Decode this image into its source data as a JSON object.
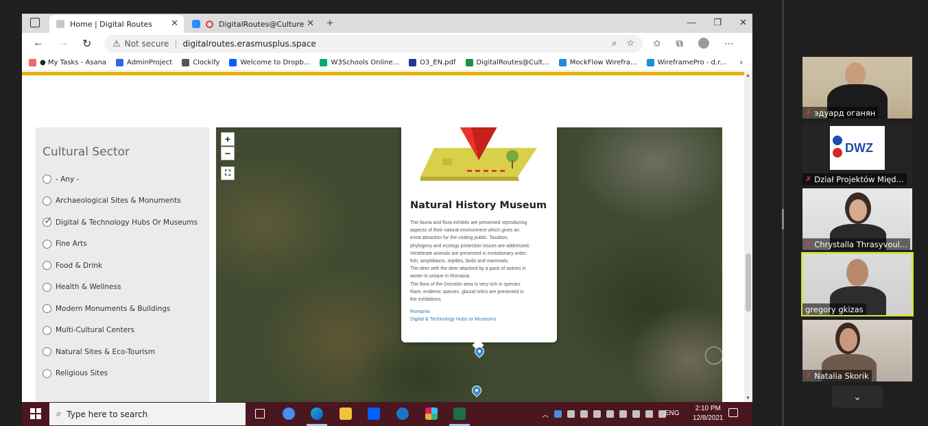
{
  "browser": {
    "tabs": [
      {
        "label": "Home | Digital Routes",
        "active": true
      },
      {
        "label": "DigitalRoutes@Culture",
        "active": false
      }
    ],
    "address": {
      "security": "Not secure",
      "url": "digitalroutes.erasmusplus.space"
    },
    "bookmarks": [
      {
        "label": "● My Tasks - Asana",
        "color": "#f06a6a"
      },
      {
        "label": "AdminProject",
        "color": "#2d6ad9"
      },
      {
        "label": "Clockify",
        "color": "#555555"
      },
      {
        "label": "Welcome to Dropb...",
        "color": "#0061fe"
      },
      {
        "label": "W3Schools Online...",
        "color": "#04aa6d"
      },
      {
        "label": "O3_EN.pdf",
        "color": "#1f3a93"
      },
      {
        "label": "DigitalRoutes@Cult...",
        "color": "#1e8e3e"
      },
      {
        "label": "MockFlow Wirefra...",
        "color": "#1b8fd6"
      },
      {
        "label": "WireframePro - d.r...",
        "color": "#1b8fd6"
      }
    ]
  },
  "sidebar": {
    "title": "Cultural Sector",
    "items": [
      {
        "label": "- Any -",
        "checked": false
      },
      {
        "label": "Archaeological Sites & Monuments",
        "checked": false
      },
      {
        "label": "Digital & Technology Hubs Or Museums",
        "checked": true
      },
      {
        "label": "Fine Arts",
        "checked": false
      },
      {
        "label": "Food & Drink",
        "checked": false
      },
      {
        "label": "Health & Wellness",
        "checked": false
      },
      {
        "label": "Modern Monuments & Buildings",
        "checked": false
      },
      {
        "label": "Multi-Cultural Centers",
        "checked": false
      },
      {
        "label": "Natural Sites & Eco-Tourism",
        "checked": false
      },
      {
        "label": "Religious Sites",
        "checked": false
      }
    ]
  },
  "map": {
    "zoom_in": "+",
    "zoom_out": "−",
    "popup": {
      "title": "Natural History Museum",
      "lines": [
        "The fauna and flora exhibits are presented reproducing",
        "aspects of their natural environment which gives an",
        "extra attraction for the visiting public. Taxation,",
        "phylogeny and ecology protection issues are addressed.",
        "Vertebrate animals are presented in evolutionary order:",
        "fish, amphibians, reptiles, birds and mammals.",
        "The deer with the deer attacked by a pack of wolves in",
        "winter is unique in Romania.",
        "The flora of the Dornelor area is very rich in species.",
        "Rare, endemic species, glacial relics are presented in",
        "the exhibitions"
      ],
      "country_link": "Romania",
      "category_link": "Digital & Technology Hubs or Museums"
    }
  },
  "taskbar": {
    "search_placeholder": "Type here to search",
    "language": "ENG",
    "time": "2:10 PM",
    "date": "12/8/2021"
  },
  "participants": [
    {
      "name": "эдуард оганян",
      "muted": true
    },
    {
      "name": "Dział Projektów Międ...",
      "muted": true,
      "logo": "DWZ"
    },
    {
      "name": "Chrystalla Thrasyvoul...",
      "muted": true
    },
    {
      "name": "gregory gkizas",
      "muted": false,
      "active": true
    },
    {
      "name": "Natalia Skorik",
      "muted": true
    }
  ],
  "colors": {
    "accent_yellow": "#e9b200",
    "link_blue": "#2a7db3",
    "marker_blue": "#3a88c8",
    "active_speaker": "#d9e04a"
  }
}
